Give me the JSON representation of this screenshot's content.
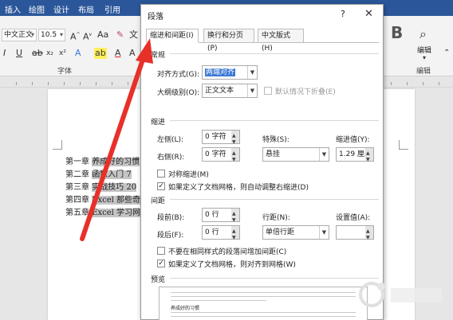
{
  "ribbon": {
    "tabs": [
      "插入",
      "绘图",
      "设计",
      "布局",
      "引用"
    ],
    "font_name": "中文正文",
    "font_size": "10.5",
    "font_group_label": "字体",
    "right_group_label": "编辑",
    "edit_button_label": "编辑"
  },
  "document": {
    "lines": [
      {
        "prefix": "第一章",
        "selected": "养成好的习惯"
      },
      {
        "prefix": "第二章",
        "selected": "函数入门 7"
      },
      {
        "prefix": "第三章",
        "selected": "实战技巧 20"
      },
      {
        "prefix": "第四章",
        "selected": "Excel 那些奇门"
      },
      {
        "prefix": "第五章",
        "selected": "Excel 学习网站"
      }
    ]
  },
  "dialog": {
    "title": "段落",
    "help": "?",
    "tabs": [
      "缩进和间距(I)",
      "换行和分页(P)",
      "中文版式(H)"
    ],
    "general": {
      "section": "常规",
      "alignment_label": "对齐方式(G):",
      "alignment_value": "两端对齐",
      "outline_label": "大纲级别(O):",
      "outline_value": "正文文本",
      "collapse_label": "默认情况下折叠(E)"
    },
    "indent": {
      "section": "缩进",
      "left_label": "左侧(L):",
      "left_value": "0 字符",
      "right_label": "右侧(R):",
      "right_value": "0 字符",
      "special_label": "特殊(S):",
      "special_value": "悬挂",
      "by_label": "缩进值(Y):",
      "by_value": "1.29 厘米",
      "mirror_label": "对称缩进(M)",
      "auto_adjust_label": "如果定义了文档网格，则自动调整右缩进(D)"
    },
    "spacing": {
      "section": "间距",
      "before_label": "段前(B):",
      "before_value": "0 行",
      "after_label": "段后(F):",
      "after_value": "0 行",
      "line_spacing_label": "行距(N):",
      "line_spacing_value": "单倍行距",
      "at_label": "设置值(A):",
      "no_space_label": "不要在相同样式的段落间增加间距(C)",
      "snap_grid_label": "如果定义了文档网格，则对齐到网格(W)"
    },
    "preview": {
      "section": "预览",
      "sample_text": "养成好的习惯"
    }
  },
  "colors": {
    "accent": "#2b579a",
    "arrow": "#e8302a",
    "selection": "#3a78d6"
  }
}
